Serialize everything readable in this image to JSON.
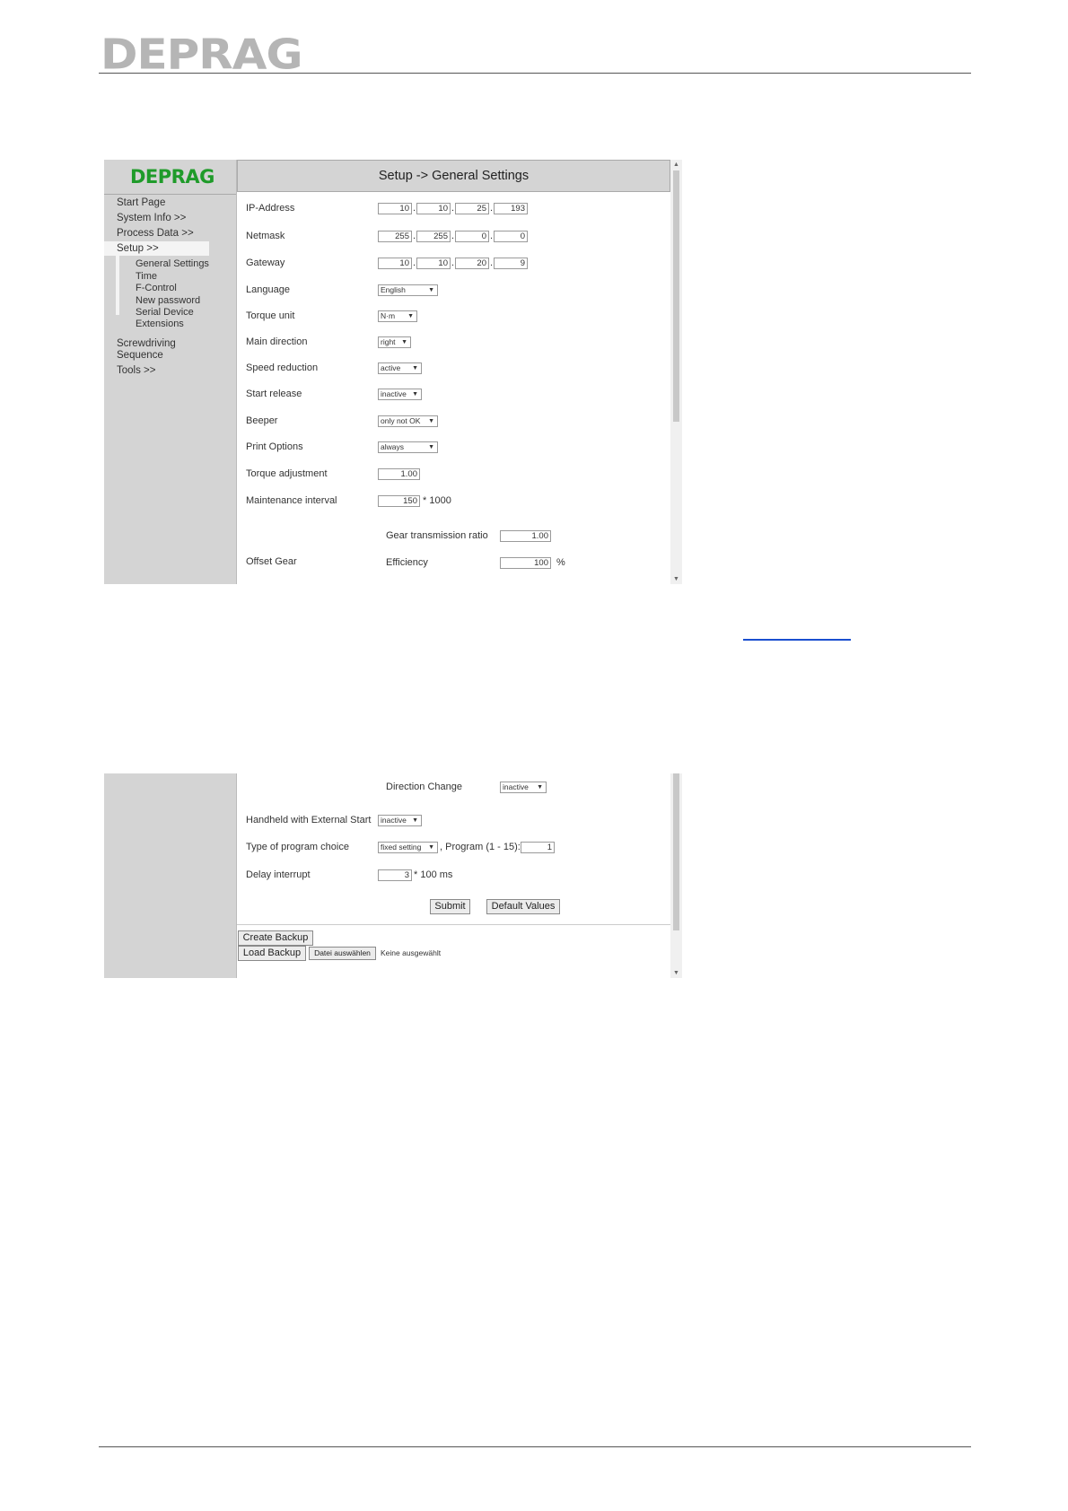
{
  "brand": "DEPRAG",
  "screen1": {
    "logo": "DEPRAG",
    "title": "Setup -> General Settings",
    "nav": {
      "start_page": "Start Page",
      "system_info": "System Info >>",
      "process_data": "Process Data >>",
      "setup": "Setup >>",
      "general_settings": "General Settings",
      "time": "Time",
      "f_control": "F-Control",
      "new_password": "New password",
      "serial_device": "Serial Device",
      "extensions": "Extensions",
      "screwdriving_sequence": "Screwdriving Sequence",
      "screwdriving": "Screwdriving",
      "sequence": "Sequence",
      "tools": "Tools >>"
    },
    "fields": {
      "ip_label": "IP-Address",
      "ip": [
        "10",
        "10",
        "25",
        "193"
      ],
      "netmask_label": "Netmask",
      "netmask": [
        "255",
        "255",
        "0",
        "0"
      ],
      "gateway_label": "Gateway",
      "gateway": [
        "10",
        "10",
        "20",
        "9"
      ],
      "language_label": "Language",
      "language": "English",
      "torque_unit_label": "Torque unit",
      "torque_unit": "N·m",
      "main_direction_label": "Main direction",
      "main_direction": "right",
      "speed_reduction_label": "Speed reduction",
      "speed_reduction": "active",
      "start_release_label": "Start release",
      "start_release": "inactive",
      "beeper_label": "Beeper",
      "beeper": "only not OK",
      "print_options_label": "Print Options",
      "print_options": "always",
      "torque_adjustment_label": "Torque adjustment",
      "torque_adjustment": "1.00",
      "maintenance_label": "Maintenance interval",
      "maintenance": "150",
      "maintenance_unit": "* 1000",
      "offset_gear_label": "Offset Gear",
      "gear_ratio_label": "Gear transmission ratio",
      "gear_ratio": "1.00",
      "efficiency_label": "Efficiency",
      "efficiency": "100",
      "efficiency_unit": "%"
    }
  },
  "screen2": {
    "direction_change_label": "Direction Change",
    "direction_change": "inactive",
    "handheld_label": "Handheld with External Start",
    "handheld": "inactive",
    "program_choice_label": "Type of program choice",
    "program_choice": "fixed setting",
    "program_label": ", Program (1 - 15):",
    "program": "1",
    "delay_label": "Delay interrupt",
    "delay": "3",
    "delay_unit": "* 100 ms",
    "submit": "Submit",
    "default_values": "Default Values",
    "create_backup": "Create Backup",
    "load_backup": "Load Backup",
    "choose_file": "Datei auswählen",
    "no_file": "Keine ausgewählt"
  }
}
